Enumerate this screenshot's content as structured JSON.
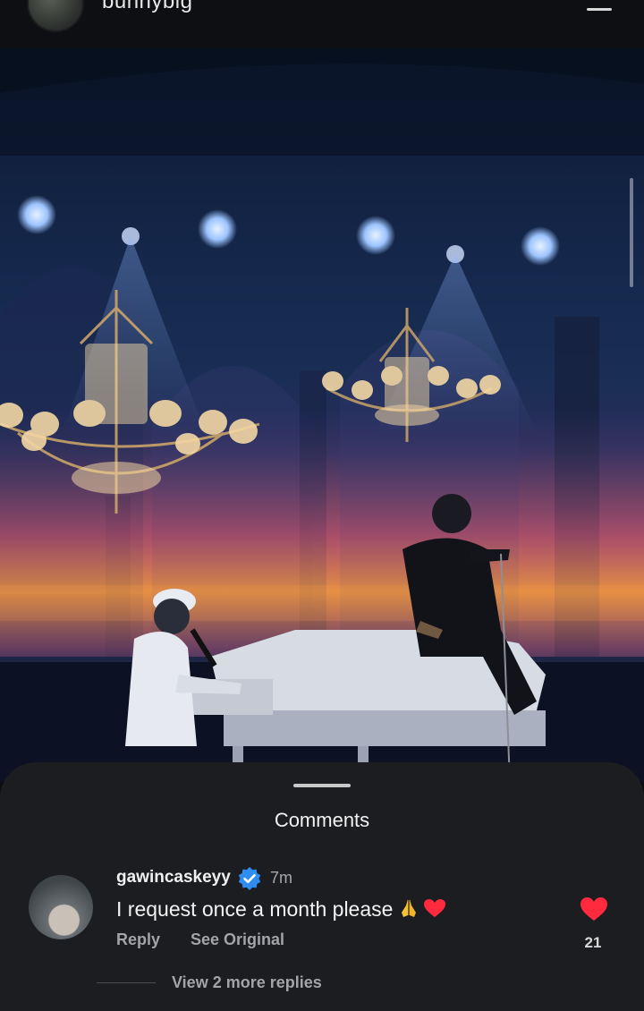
{
  "header": {
    "username": "bunnybig"
  },
  "comments_panel": {
    "title": "Comments",
    "comment": {
      "username": "gawincaskeyy",
      "time": "7m",
      "text": "I request once a month please",
      "emojis": [
        "folded-hands",
        "red-heart"
      ],
      "reply_label": "Reply",
      "see_original_label": "See Original",
      "like_count": "21"
    },
    "view_replies_label": "View 2 more replies"
  },
  "colors": {
    "sheet_bg": "#1b1d21",
    "like_heart": "#ff2a3d",
    "verified_badge": "#2f8cf0",
    "muted_text": "#a2a4a8"
  }
}
